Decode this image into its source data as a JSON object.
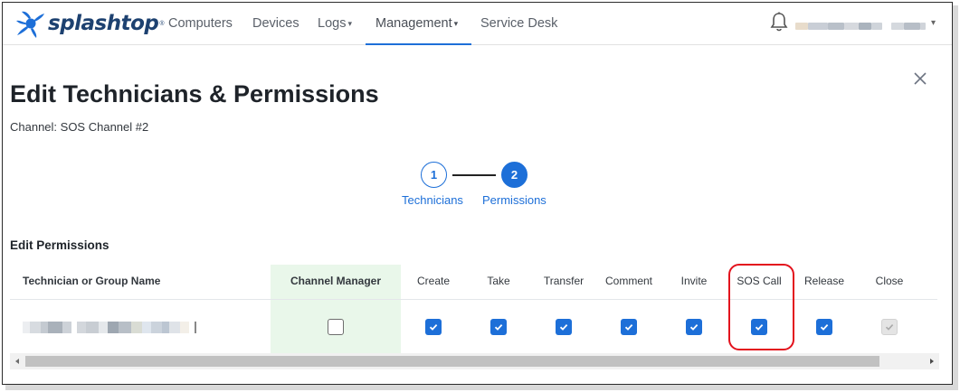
{
  "brand": {
    "name": "splashtop",
    "reg": "®",
    "accent": "#1d6fd8",
    "logo_color": "#1d4170"
  },
  "nav": {
    "items": [
      {
        "label": "Computers",
        "has_caret": false
      },
      {
        "label": "Devices",
        "has_caret": false
      },
      {
        "label": "Logs",
        "has_caret": true
      },
      {
        "label": "Management",
        "has_caret": true,
        "active": true
      },
      {
        "label": "Service Desk",
        "has_caret": false
      }
    ],
    "caret": "▾",
    "user_menu_caret": "▾",
    "icons": {
      "notifications": "bell-icon",
      "close": "close-icon"
    }
  },
  "page": {
    "title": "Edit Technicians & Permissions",
    "channel_label": "Channel: SOS Channel #2"
  },
  "stepper": {
    "steps": [
      {
        "number": "1",
        "label": "Technicians",
        "state": "completed"
      },
      {
        "number": "2",
        "label": "Permissions",
        "state": "active"
      }
    ]
  },
  "permissions": {
    "section_title": "Edit Permissions",
    "columns": {
      "name": "Technician or Group Name",
      "channel_manager": "Channel Manager",
      "create": "Create",
      "take": "Take",
      "transfer": "Transfer",
      "comment": "Comment",
      "invite": "Invite",
      "sos_call": "SOS Call",
      "release": "Release",
      "close": "Close"
    },
    "row": {
      "channel_manager": false,
      "create": true,
      "take": true,
      "transfer": true,
      "comment": true,
      "invite": true,
      "sos_call": true,
      "release": true,
      "close": "checked-disabled"
    },
    "highlighted_column": "SOS Call",
    "highlight_color": "#e3121d",
    "channel_manager_bg": "#e9f7ea"
  },
  "scrollbar": {
    "left_arrow": "◂",
    "right_arrow": "▸"
  }
}
